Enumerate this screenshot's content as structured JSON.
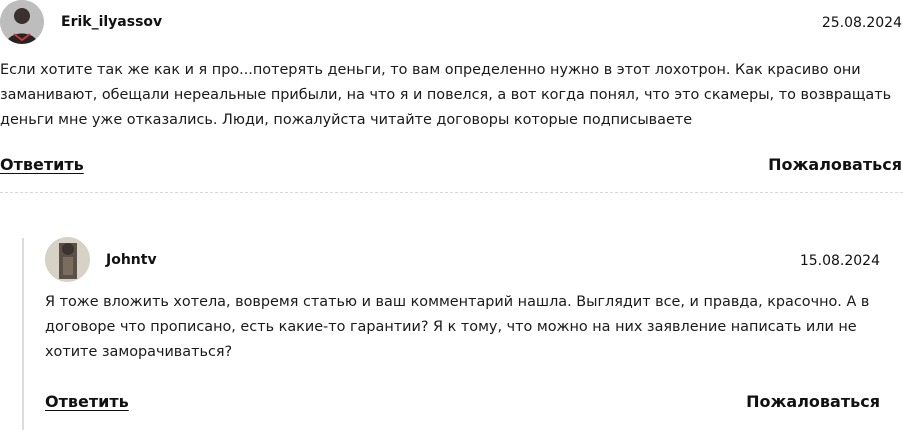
{
  "comments": [
    {
      "author": "Erik_ilyassov",
      "date": "25.08.2024",
      "text": "Если хотите так же как и я про...потерять деньги, то вам определенно нужно в этот лохотрон. Как красиво они заманивают, обещали нереальные прибыли, на что я и повелся, а вот когда понял, что это скамеры, то возвращать деньги мне уже отказались. Люди, пожалуйста читайте договоры которые подписываете",
      "reply_label": "Ответить",
      "report_label": "Пожаловаться"
    },
    {
      "author": "Johntv",
      "date": "15.08.2024",
      "text": "Я тоже вложить хотела, вовремя статью и ваш комментарий нашла. Выглядит все, и правда, красочно. А в договоре что прописано, есть какие-то гарантии? Я к тому, что можно на них заявление написать или не хотите заморачиваться?",
      "reply_label": "Ответить",
      "report_label": "Пожаловаться"
    }
  ]
}
